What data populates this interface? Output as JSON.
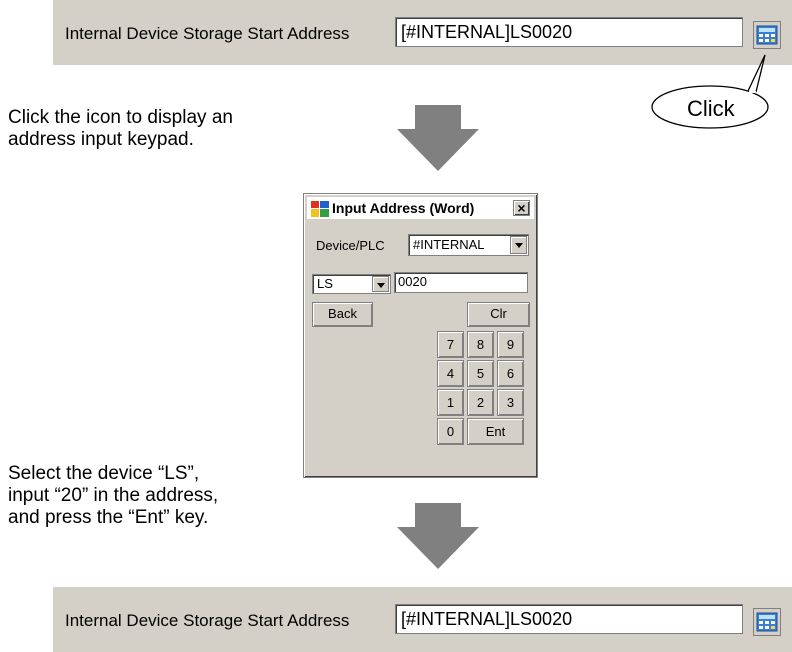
{
  "address_field": {
    "label": "Internal Device Storage Start Address",
    "value": "[#INTERNAL]LS0020"
  },
  "callout": {
    "text": "Click"
  },
  "instructions": {
    "step1": [
      "Click the icon to display an",
      "address input keypad."
    ],
    "step2": [
      "Select the device “LS”,",
      "input “20” in the address,",
      "and press the “Ent” key."
    ]
  },
  "dialog": {
    "title": "Input Address (Word)",
    "close": "×",
    "device_plc_label": "Device/PLC",
    "device_plc_value": "#INTERNAL",
    "device_value": "LS",
    "address_value": "0020",
    "back_label": "Back",
    "clr_label": "Clr",
    "keys": [
      "7",
      "8",
      "9",
      "4",
      "5",
      "6",
      "1",
      "2",
      "3",
      "0"
    ],
    "ent_label": "Ent"
  },
  "colors": {
    "arrow": "#808080",
    "panel": "#d4d0c8"
  },
  "icons": [
    "keypad-icon",
    "dialog-app-icon",
    "dropdown-arrow-icon"
  ]
}
